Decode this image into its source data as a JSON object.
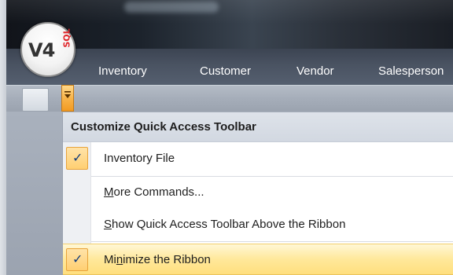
{
  "app": {
    "logo_text": "V4",
    "logo_sql": "SQL"
  },
  "ribbon": {
    "tabs": [
      {
        "label": "Inventory"
      },
      {
        "label": "Customer"
      },
      {
        "label": "Vendor"
      },
      {
        "label": "Salesperson"
      }
    ]
  },
  "qat_menu": {
    "header": "Customize Quick Access Toolbar",
    "items": [
      {
        "label": "Inventory File",
        "checked": true,
        "accel": ""
      },
      {
        "label": "More Commands...",
        "checked": false,
        "accel": "M"
      },
      {
        "label": "Show Quick Access Toolbar Above the Ribbon",
        "checked": false,
        "accel": "S"
      },
      {
        "label": "Minimize the Ribbon",
        "checked": true,
        "accel": "n",
        "highlighted": true
      }
    ]
  },
  "colors": {
    "accent_orange": "#f8b44a",
    "highlight_yellow": "#ffe89a",
    "ribbon_dark": "#4a5362"
  }
}
